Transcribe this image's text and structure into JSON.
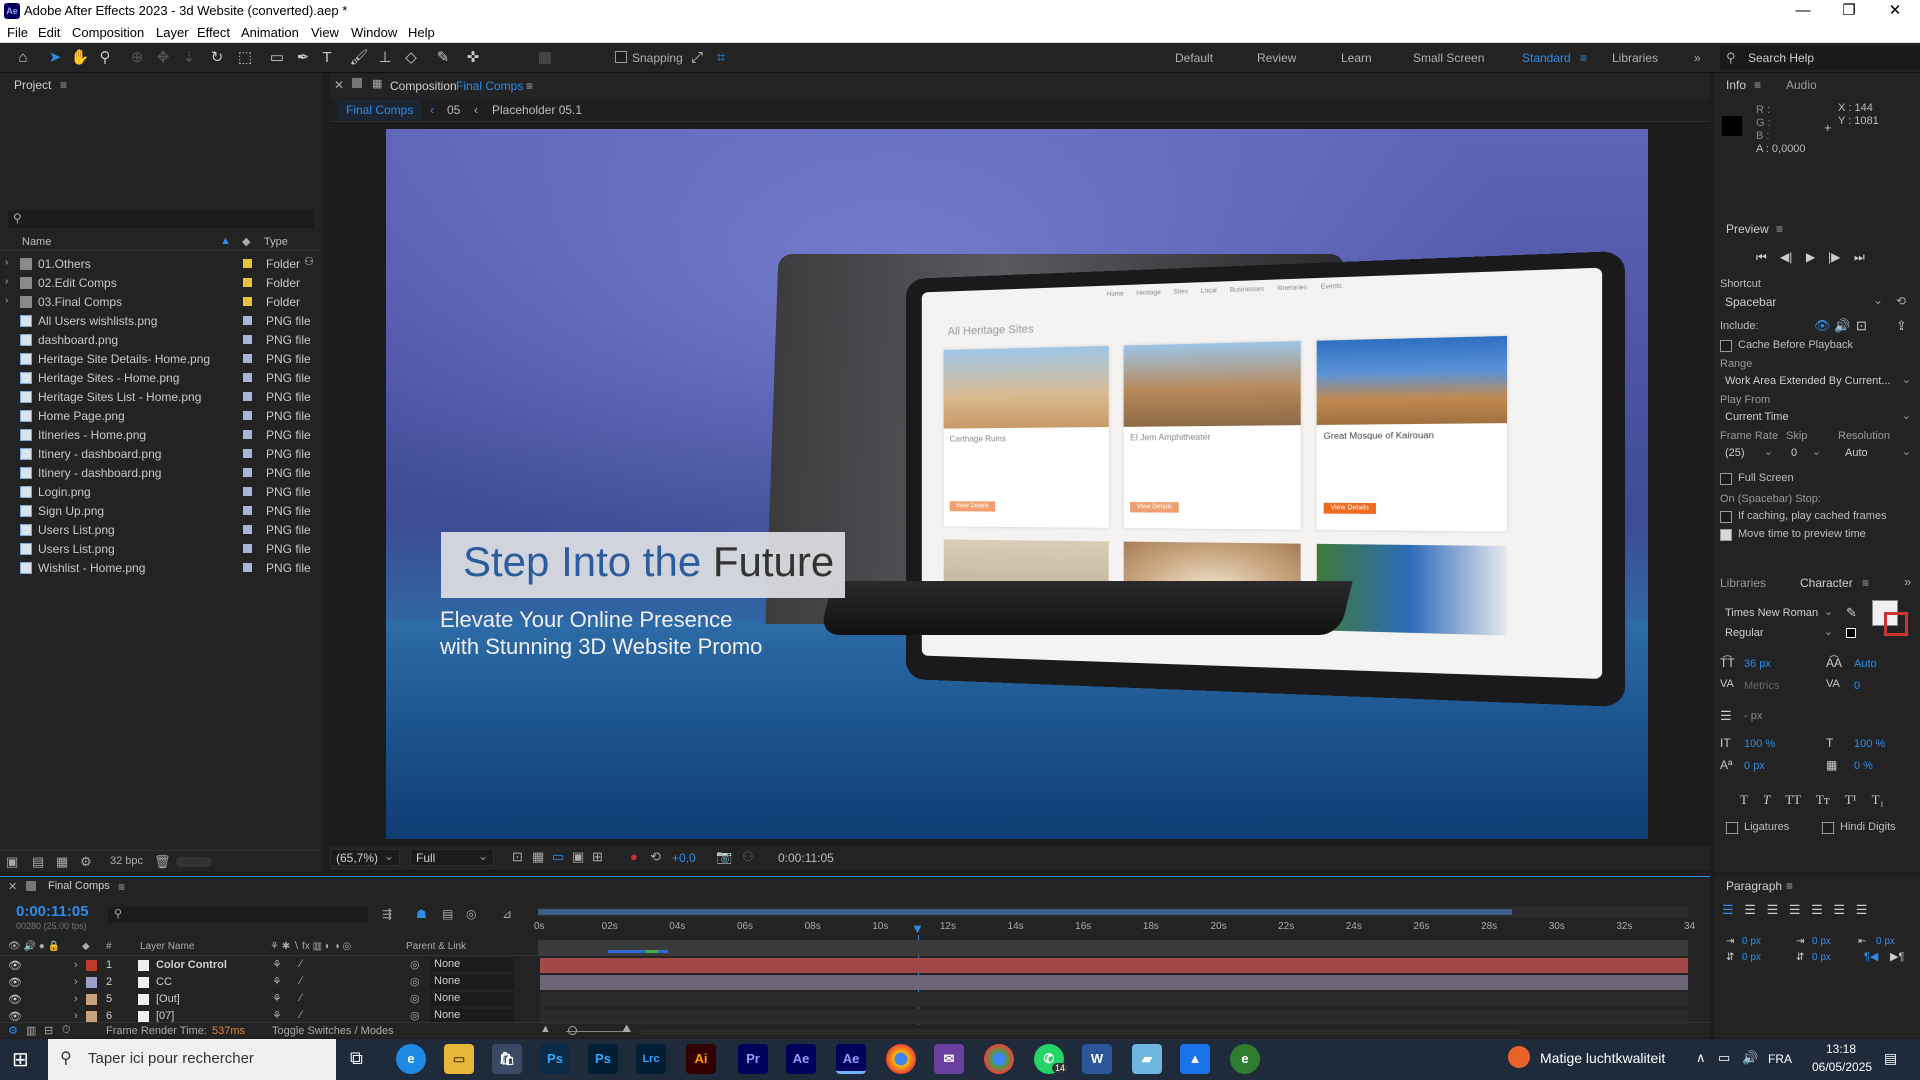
{
  "window": {
    "title": "Adobe After Effects 2023 - 3d Website (converted).aep *",
    "app_icon": "Ae"
  },
  "menu": [
    "File",
    "Edit",
    "Composition",
    "Layer",
    "Effect",
    "Animation",
    "View",
    "Window",
    "Help"
  ],
  "toolbar": {
    "snapping": "Snapping",
    "workspaces": [
      "Default",
      "Review",
      "Learn",
      "Small Screen",
      "Standard",
      "Libraries"
    ],
    "active_workspace": "Standard",
    "search_help": "Search Help"
  },
  "project": {
    "title": "Project",
    "columns": {
      "name": "Name",
      "type": "Type"
    },
    "items": [
      {
        "name": "01.Others",
        "type": "Folder",
        "kind": "folder"
      },
      {
        "name": "02.Edit Comps",
        "type": "Folder",
        "kind": "folder"
      },
      {
        "name": "03.Final Comps",
        "type": "Folder",
        "kind": "folder"
      },
      {
        "name": "All Users wishlists.png",
        "type": "PNG file",
        "kind": "file"
      },
      {
        "name": "dashboard.png",
        "type": "PNG file",
        "kind": "file"
      },
      {
        "name": "Heritage Site Details- Home.png",
        "type": "PNG file",
        "kind": "file"
      },
      {
        "name": "Heritage Sites - Home.png",
        "type": "PNG file",
        "kind": "file"
      },
      {
        "name": "Heritage Sites List - Home.png",
        "type": "PNG file",
        "kind": "file"
      },
      {
        "name": "Home Page.png",
        "type": "PNG file",
        "kind": "file"
      },
      {
        "name": "Itineries - Home.png",
        "type": "PNG file",
        "kind": "file"
      },
      {
        "name": "Itinery - dashboard.png",
        "type": "PNG file",
        "kind": "file"
      },
      {
        "name": "Itinery - dashboard.png",
        "type": "PNG file",
        "kind": "file"
      },
      {
        "name": "Login.png",
        "type": "PNG file",
        "kind": "file"
      },
      {
        "name": "Sign Up.png",
        "type": "PNG file",
        "kind": "file"
      },
      {
        "name": "Users List.png",
        "type": "PNG file",
        "kind": "file"
      },
      {
        "name": "Users List.png",
        "type": "PNG file",
        "kind": "file"
      },
      {
        "name": "Wishlist - Home.png",
        "type": "PNG file",
        "kind": "file"
      }
    ],
    "bpc": "32 bpc"
  },
  "composition": {
    "header": "Composition",
    "name": "Final Comps",
    "breadcrumb": [
      "Final Comps",
      "05",
      "Placeholder 05.1"
    ],
    "zoom": "(65,7%)",
    "resolution": "Full",
    "exposure": "+0,0",
    "timecode": "0:00:11:05"
  },
  "viewer": {
    "headline_a": "Step Into the ",
    "headline_b": "Future",
    "subline_1": "Elevate Your Online Presence",
    "subline_2": "with Stunning 3D Website Promo",
    "screen": {
      "title": "All Heritage Sites",
      "nav": [
        "Home",
        "Heritage Sites",
        "Local",
        "Businesses",
        "Itineraries",
        "Events"
      ],
      "cards": [
        "Carthage Ruins",
        "El Jem Amphitheater",
        "Great Mosque of Kairouan"
      ],
      "card_button": "View Details"
    }
  },
  "info": {
    "tab1": "Info",
    "tab2": "Audio",
    "r": "R :",
    "g": "G :",
    "b": "B :",
    "a": "A : 0,0000",
    "x": "X : 144",
    "y": "Y : 1081"
  },
  "preview": {
    "title": "Preview",
    "shortcut_label": "Shortcut",
    "shortcut": "Spacebar",
    "include": "Include:",
    "cache": "Cache Before Playback",
    "range_label": "Range",
    "range": "Work Area Extended By Current...",
    "play_from_label": "Play From",
    "play_from": "Current Time",
    "frame_rate_label": "Frame Rate",
    "skip_label": "Skip",
    "resolution_label": "Resolution",
    "frame_rate": "(25)",
    "skip": "0",
    "resolution": "Auto",
    "full_screen": "Full Screen",
    "stop_label": "On (Spacebar) Stop:",
    "if_caching": "If caching, play cached frames",
    "move_time": "Move time to preview time"
  },
  "character": {
    "libraries": "Libraries",
    "title": "Character",
    "font": "Times New Roman",
    "style": "Regular",
    "size": "36 px",
    "leading": "Auto",
    "kerning": "Metrics",
    "tracking": "0",
    "stroke": "- px",
    "vscale": "100 %",
    "hscale": "100 %",
    "baseline": "0 px",
    "tsume": "0 %",
    "ligatures": "Ligatures",
    "hindi": "Hindi Digits"
  },
  "paragraph": {
    "title": "Paragraph",
    "values": [
      "0 px",
      "0 px",
      "0 px",
      "0 px",
      "0 px"
    ]
  },
  "timeline": {
    "comp": "Final Comps",
    "time": "0:00:11:05",
    "frames": "00280 (25.00 fps)",
    "layer_name_col": "Layer Name",
    "parent_col": "Parent & Link",
    "ruler": [
      "0s",
      "02s",
      "04s",
      "06s",
      "08s",
      "10s",
      "12s",
      "14s",
      "16s",
      "18s",
      "20s",
      "22s",
      "24s",
      "26s",
      "28s",
      "30s",
      "32s",
      "34"
    ],
    "layers": [
      {
        "num": "1",
        "name": "Color Control",
        "parent": "None",
        "label": "#c0392b"
      },
      {
        "num": "2",
        "name": "CC",
        "parent": "None",
        "label": "#9aa0c8"
      },
      {
        "num": "5",
        "name": "[Out]",
        "parent": "None",
        "label": "#c8a27a"
      },
      {
        "num": "6",
        "name": "[07]",
        "parent": "None",
        "label": "#c8a27a"
      }
    ],
    "render_time_label": "Frame Render Time:",
    "render_time": "537ms",
    "toggle": "Toggle Switches / Modes"
  },
  "taskbar": {
    "search": "Taper ici pour rechercher",
    "weather": "Matige luchtkwaliteit",
    "lang": "FRA",
    "time": "13:18",
    "date": "06/05/2025",
    "apps": [
      "Ps",
      "Ps",
      "Lrc",
      "Ai",
      "Pr",
      "Ae",
      "Ae"
    ],
    "badge": "14"
  },
  "colors": {
    "accent": "#2d8ceb",
    "bg": "#1d1d1d",
    "panel": "#232323",
    "timeline_bar_red": "#a34848",
    "timeline_bar_purple": "#6d6478"
  }
}
